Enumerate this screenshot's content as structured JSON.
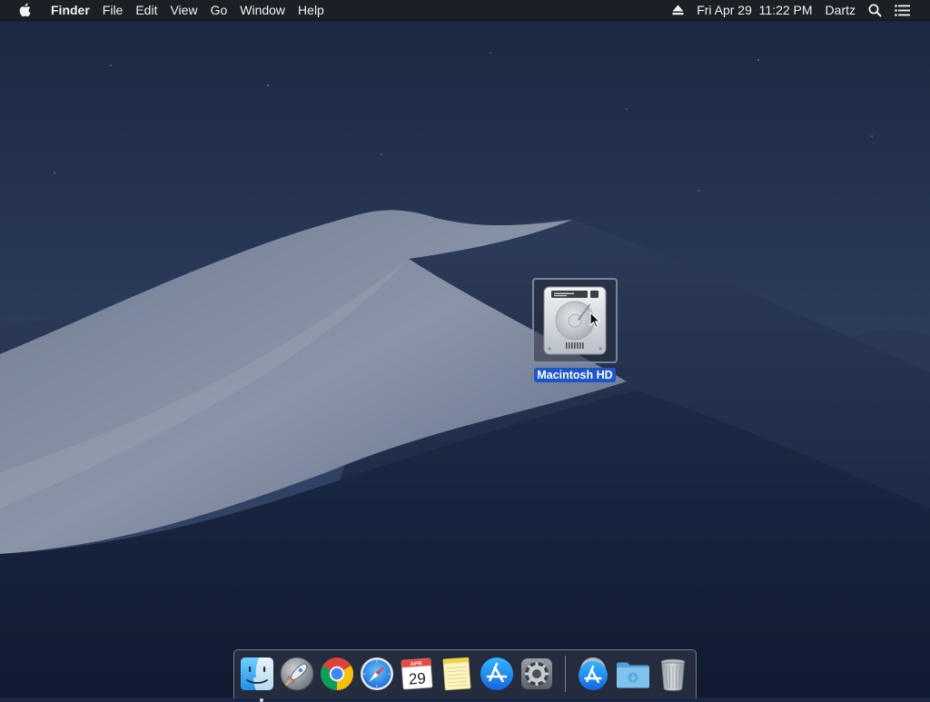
{
  "menubar": {
    "app_name": "Finder",
    "menus": [
      "File",
      "Edit",
      "View",
      "Go",
      "Window",
      "Help"
    ],
    "clock": "Fri Apr 29  11:22 PM",
    "user": "Dartz",
    "icons": {
      "apple": "apple-menu-icon",
      "eject": "eject-icon",
      "spotlight": "spotlight-search-icon",
      "notifications": "notification-center-icon"
    }
  },
  "desktop": {
    "icons": [
      {
        "label": "Macintosh HD",
        "icon": "hard-drive-icon",
        "selected": true
      }
    ]
  },
  "dock": {
    "items": [
      {
        "icon": "finder-icon",
        "running": true
      },
      {
        "icon": "launchpad-icon",
        "running": false
      },
      {
        "icon": "chrome-icon",
        "running": false
      },
      {
        "icon": "safari-icon",
        "running": false
      },
      {
        "icon": "calendar-icon",
        "month": "APR",
        "day": "29",
        "running": false
      },
      {
        "icon": "notes-icon",
        "running": false
      },
      {
        "icon": "app-store-icon",
        "running": false
      },
      {
        "icon": "system-preferences-icon",
        "running": false
      },
      {
        "icon": "app-store-downloads-icon",
        "running": false
      },
      {
        "icon": "downloads-folder-icon",
        "running": false
      },
      {
        "icon": "trash-icon",
        "running": false
      }
    ]
  },
  "colors": {
    "menubar_bg": "#1c1e24",
    "selection": "#1e55c9",
    "sky_top": "#1b2740",
    "sky_bottom": "#34476a"
  }
}
